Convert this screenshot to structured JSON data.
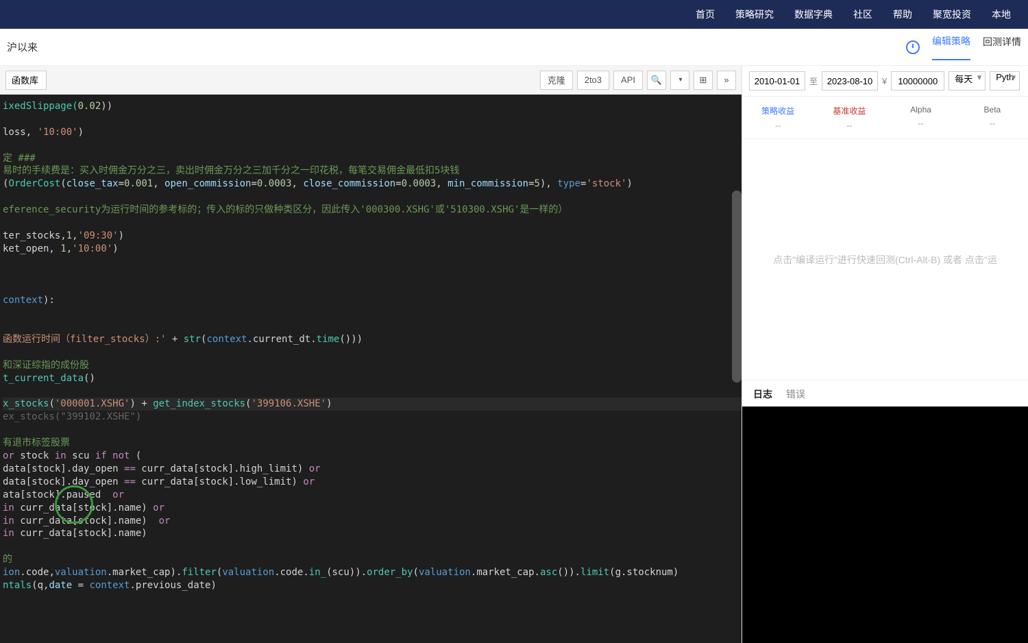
{
  "nav": {
    "items": [
      "首页",
      "策略研究",
      "数据字典",
      "社区",
      "帮助",
      "聚宽投资",
      "本地"
    ]
  },
  "titlebar": {
    "title": "沪以来",
    "tab_edit": "编辑策略",
    "tab_result": "回测详情"
  },
  "toolbar": {
    "lib": "函数库",
    "clone": "克隆",
    "to23": "2to3",
    "api": "API"
  },
  "params": {
    "date_from": "2010-01-01",
    "date_to": "2023-08-10",
    "sep": "至",
    "currency": "¥",
    "capital": "10000000",
    "freq": "每天",
    "lang": "Pyth"
  },
  "metrics": [
    {
      "label": "策略收益",
      "value": "--",
      "cls": "m-blue"
    },
    {
      "label": "基准收益",
      "value": "--",
      "cls": "m-red"
    },
    {
      "label": "Alpha",
      "value": "--",
      "cls": "m-gray"
    },
    {
      "label": "Beta",
      "value": "--",
      "cls": "m-gray"
    }
  ],
  "placeholder": "点击\"编译运行\"进行快速回测(Ctrl-Alt-B) 或者 点击\"运",
  "log_tabs": {
    "log": "日志",
    "error": "错误"
  },
  "code": {
    "l1a": "ixedSlippage(",
    "l1b": "0.02",
    "l1c": "))",
    "l2a": "loss, ",
    "l2b": "'10:00'",
    "l2c": ")",
    "l3": "定 ###",
    "l4": "易时的手续费是：买入时佣金万分之三，卖出时佣金万分之三加千分之一印花税，每笔交易佣金最低扣5块钱",
    "l5a": "(",
    "l5b": "OrderCost",
    "l5c": "(",
    "l5d": "close_tax",
    "l5e": "=",
    "l5f": "0.001",
    "l5g": ", ",
    "l5h": "open_commission",
    "l5i": "=",
    "l5j": "0.0003",
    "l5k": ", ",
    "l5l": "close_commission",
    "l5m": "=",
    "l5n": "0.0003",
    "l5o": ", ",
    "l5p": "min_commission",
    "l5q": "=",
    "l5r": "5",
    "l5s": "), ",
    "l5t": "type",
    "l5u": "=",
    "l5v": "'stock'",
    "l5w": ")",
    "l6": "eference_security为运行时间的参考标的；传入的标的只做种类区分，因此传入'000300.XSHG'或'510300.XSHG'是一样的）",
    "l7a": "ter_stocks,",
    "l7b": "1",
    "l7c": ",",
    "l7d": "'09:30'",
    "l7e": ")",
    "l8a": "ket_open, ",
    "l8b": "1",
    "l8c": ",",
    "l8d": "'10:00'",
    "l8e": ")",
    "l9a": "context",
    "l9b": "):",
    "l10a": "函数运行时间（filter_stocks）:'",
    "l10b": " + ",
    "l10c": "str",
    "l10d": "(",
    "l10e": "context",
    "l10f": ".current_dt.",
    "l10g": "time",
    "l10h": "()))",
    "l11": "和深证综指的成份股",
    "l12a": "t_current_data",
    "l12b": "()",
    "l13a": "x_stocks",
    "l13b": "(",
    "l13c": "'000001.XSHG'",
    "l13d": ")",
    "l13e": " + ",
    "l13f": "get_index_stocks",
    "l13g": "(",
    "l13h": "'399106.XSHE'",
    "l13i": ")",
    "l14a": "ex_stocks(",
    "l14b": "\"399102.XSHE\"",
    "l14c": ")",
    "l15": "有退市标签股票",
    "l16a": "or",
    "l16b": " stock ",
    "l16c": "in",
    "l16d": " scu ",
    "l16e": "if",
    "l16f": " not",
    "l16g": " (",
    "l17a": "data[stock].day_open ",
    "l17b": "==",
    "l17c": " curr_data[stock].high_limit) ",
    "l17d": "or",
    "l18a": "data[stock].day_open ",
    "l18b": "==",
    "l18c": " curr_data[stock].low_limit) ",
    "l18d": "or",
    "l19a": "ata[stock].paused  ",
    "l19b": "or",
    "l20a": "in",
    "l20b": " curr_data[stock].name) ",
    "l20c": "or",
    "l21a": "in",
    "l21b": " curr_data[stock].name)  ",
    "l21c": "or",
    "l22a": "in",
    "l22b": " curr_data[stock].name)",
    "l23": "的",
    "l24a": "ion",
    "l24b": ".code,",
    "l24c": "valuation",
    "l24d": ".market_cap).",
    "l24e": "filter",
    "l24f": "(",
    "l24g": "valuation",
    "l24h": ".code.",
    "l24i": "in_",
    "l24j": "(scu)).",
    "l24k": "order_by",
    "l24l": "(",
    "l24m": "valuation",
    "l24n": ".market_cap.",
    "l24o": "asc",
    "l24p": "()).",
    "l24q": "limit",
    "l24r": "(g.stocknum)",
    "l25a": "ntals",
    "l25b": "(q,",
    "l25c": "date",
    "l25d": " = ",
    "l25e": "context",
    "l25f": ".previous_date)"
  }
}
